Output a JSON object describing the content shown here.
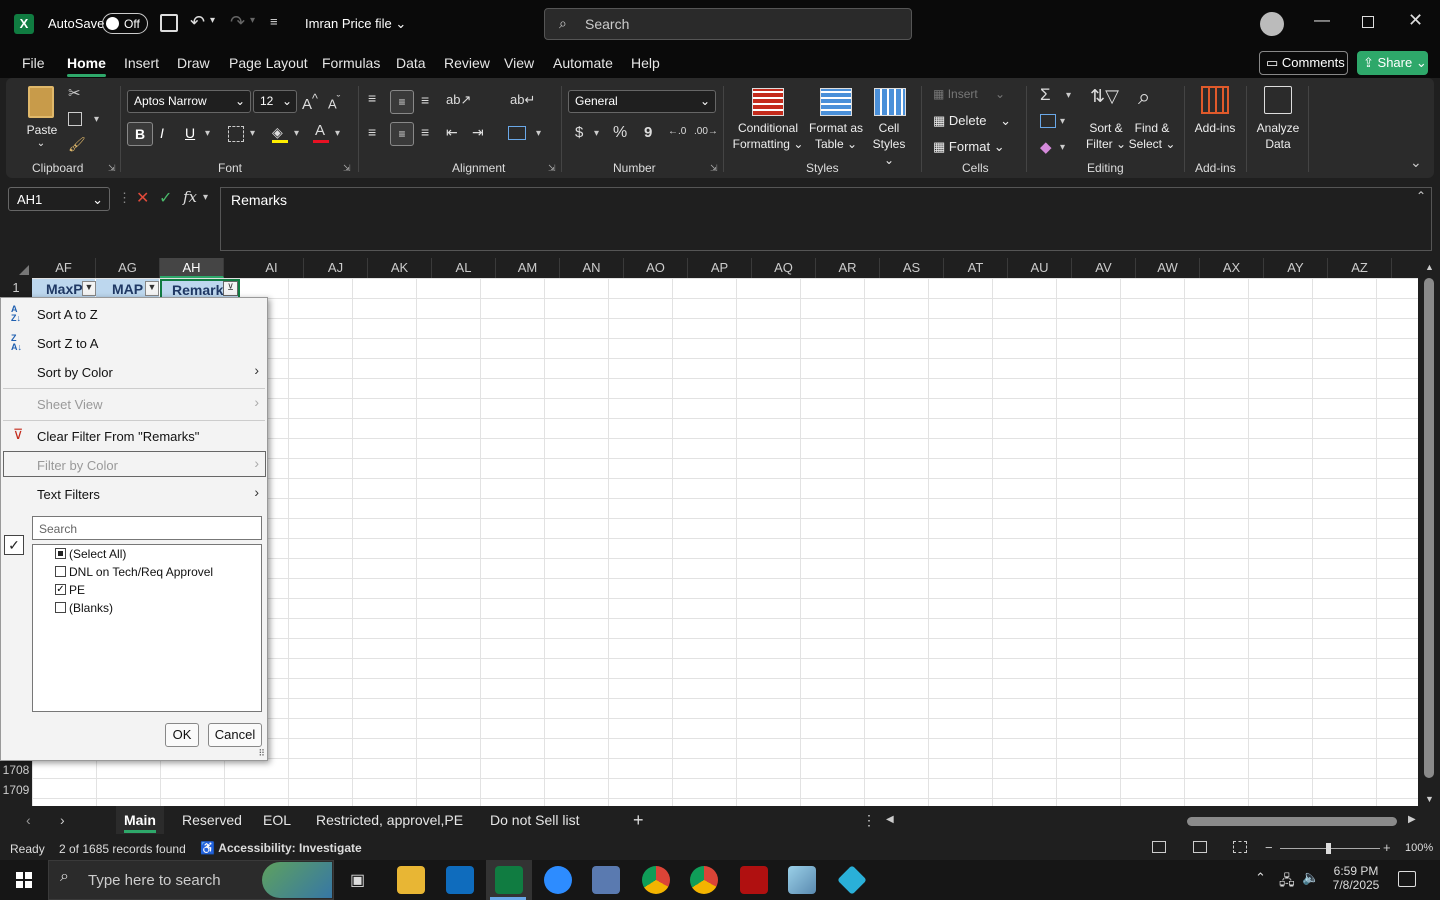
{
  "title_bar": {
    "app_logo": "X",
    "autosave_label": "AutoSave",
    "autosave_state": "Off",
    "file_name": "Imran Price file",
    "search_placeholder": "Search"
  },
  "menu_tabs": [
    "File",
    "Home",
    "Insert",
    "Draw",
    "Page Layout",
    "Formulas",
    "Data",
    "Review",
    "View",
    "Automate",
    "Help"
  ],
  "active_tab": "Home",
  "comments_label": "Comments",
  "share_label": "Share",
  "ribbon": {
    "clipboard": {
      "paste": "Paste",
      "group": "Clipboard"
    },
    "font": {
      "name": "Aptos Narrow",
      "size": "12",
      "group": "Font",
      "bold": "B",
      "italic": "I",
      "underline": "U"
    },
    "alignment": {
      "group": "Alignment"
    },
    "number": {
      "format": "General",
      "group": "Number",
      "dollar": "$",
      "percent": "%",
      "comma": "9"
    },
    "styles": {
      "cond_1": "Conditional",
      "cond_2": "Formatting",
      "fmt_table_1": "Format as",
      "fmt_table_2": "Table",
      "cell_styles_1": "Cell",
      "cell_styles_2": "Styles",
      "group": "Styles"
    },
    "cells": {
      "insert": "Insert",
      "delete": "Delete",
      "format": "Format",
      "group": "Cells"
    },
    "editing": {
      "sort_1": "Sort &",
      "sort_2": "Filter",
      "find_1": "Find &",
      "find_2": "Select",
      "group": "Editing"
    },
    "addins": {
      "addins": "Add-ins",
      "group": "Add-ins"
    },
    "analyze": {
      "line1": "Analyze",
      "line2": "Data"
    }
  },
  "formula_bar": {
    "name_box": "AH1",
    "fx": "fx",
    "content": "Remarks"
  },
  "columns": [
    "AF",
    "AG",
    "AH",
    "AI",
    "AJ",
    "AK",
    "AL",
    "AM",
    "AN",
    "AO",
    "AP",
    "AQ",
    "AR",
    "AS",
    "AT",
    "AU",
    "AV",
    "AW",
    "AX",
    "AY",
    "AZ"
  ],
  "header_cells": {
    "af": "MaxP",
    "ag": "MAP",
    "ah": "Remark"
  },
  "row_numbers": {
    "r1": "1",
    "r1708": "1708",
    "r1709": "1709"
  },
  "filter_menu": {
    "sort_az": "Sort A to Z",
    "sort_za": "Sort Z to A",
    "sort_color": "Sort by Color",
    "sheet_view": "Sheet View",
    "clear_filter": "Clear Filter From \"Remarks\"",
    "filter_color": "Filter by Color",
    "text_filters": "Text Filters",
    "search_placeholder": "Search",
    "items": [
      {
        "label": "(Select All)",
        "state": "partial"
      },
      {
        "label": "DNL on Tech/Req Approvel",
        "state": "unchecked"
      },
      {
        "label": "PE",
        "state": "checked"
      },
      {
        "label": "(Blanks)",
        "state": "unchecked"
      }
    ],
    "ok": "OK",
    "cancel": "Cancel"
  },
  "sheet_tabs": [
    "Main",
    "Reserved",
    "EOL",
    "Restricted, approvel,PE",
    "Do not Sell list"
  ],
  "active_sheet": "Main",
  "status": {
    "ready": "Ready",
    "records": "2 of 1685 records found",
    "accessibility": "Accessibility: Investigate",
    "zoom": "100%"
  },
  "taskbar": {
    "search_placeholder": "Type here to search",
    "time": "6:59 PM",
    "date": "7/8/2025"
  },
  "colors": {
    "accent_green": "#107c41",
    "tab_underline": "#2ea86a",
    "share_green": "#2ea86a"
  }
}
